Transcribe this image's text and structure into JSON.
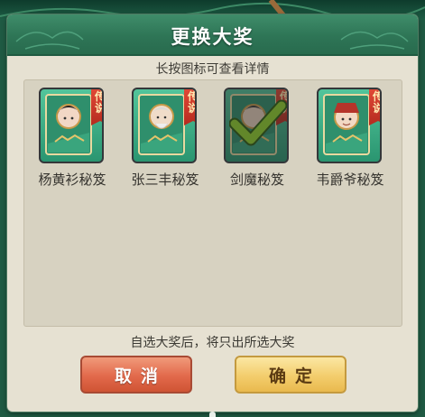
{
  "dialog": {
    "title": "更换大奖",
    "hint": "长按图标可查看详情",
    "note": "自选大奖后，将只出所选大奖"
  },
  "items": [
    {
      "label": "杨黄衫秘笈",
      "badge_line1": "传",
      "badge_line2": "说",
      "selected": false,
      "cover_icon": "young-woman-portrait"
    },
    {
      "label": "张三丰秘笈",
      "badge_line1": "传",
      "badge_line2": "说",
      "selected": false,
      "cover_icon": "old-master-portrait"
    },
    {
      "label": "剑魔秘笈",
      "badge_line1": "传",
      "badge_line2": "说",
      "selected": true,
      "cover_icon": "swordsman-portrait"
    },
    {
      "label": "韦爵爷秘笈",
      "badge_line1": "传",
      "badge_line2": "说",
      "selected": false,
      "cover_icon": "nobleman-portrait"
    }
  ],
  "buttons": {
    "cancel_label": "取消",
    "confirm_label": "确定"
  },
  "colors": {
    "title_bar": "#2e7556",
    "dialog_bg": "#e6e1d2",
    "panel_bg": "#d7d2c1",
    "cancel_button": "#e2694b",
    "confirm_button": "#f3cd6c",
    "legend_badge": "#d23b2b",
    "check_mark": "#8fd12a"
  }
}
